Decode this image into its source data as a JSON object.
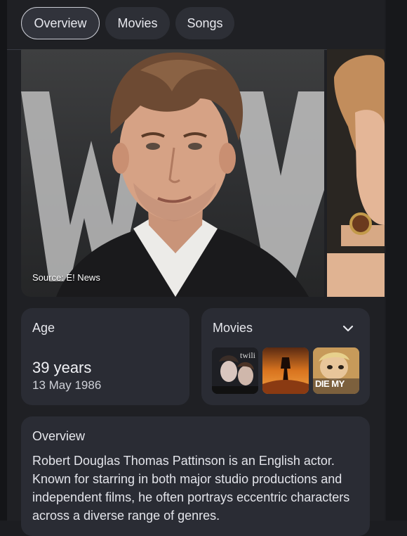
{
  "tabs": [
    {
      "label": "Overview",
      "active": true
    },
    {
      "label": "Movies",
      "active": false
    },
    {
      "label": "Songs",
      "active": false
    }
  ],
  "carousel": {
    "source_label": "Source: E! News"
  },
  "age_card": {
    "title": "Age",
    "value": "39 years",
    "date": "13 May 1986"
  },
  "movies_card": {
    "title": "Movies",
    "toggle_icon": "chevron-down-icon",
    "thumbnails": [
      {
        "caption": "twili"
      },
      {
        "caption": ""
      },
      {
        "caption": "DIE MY"
      }
    ]
  },
  "overview_card": {
    "title": "Overview",
    "text": "Robert Douglas Thomas Pattinson is an English actor. Known for starring in both major studio productions and independent films, he often portrays eccentric characters across a diverse range of genres."
  },
  "colors": {
    "background": "#1f2024",
    "card": "#2a2c34",
    "tab": "#2d2f36"
  }
}
